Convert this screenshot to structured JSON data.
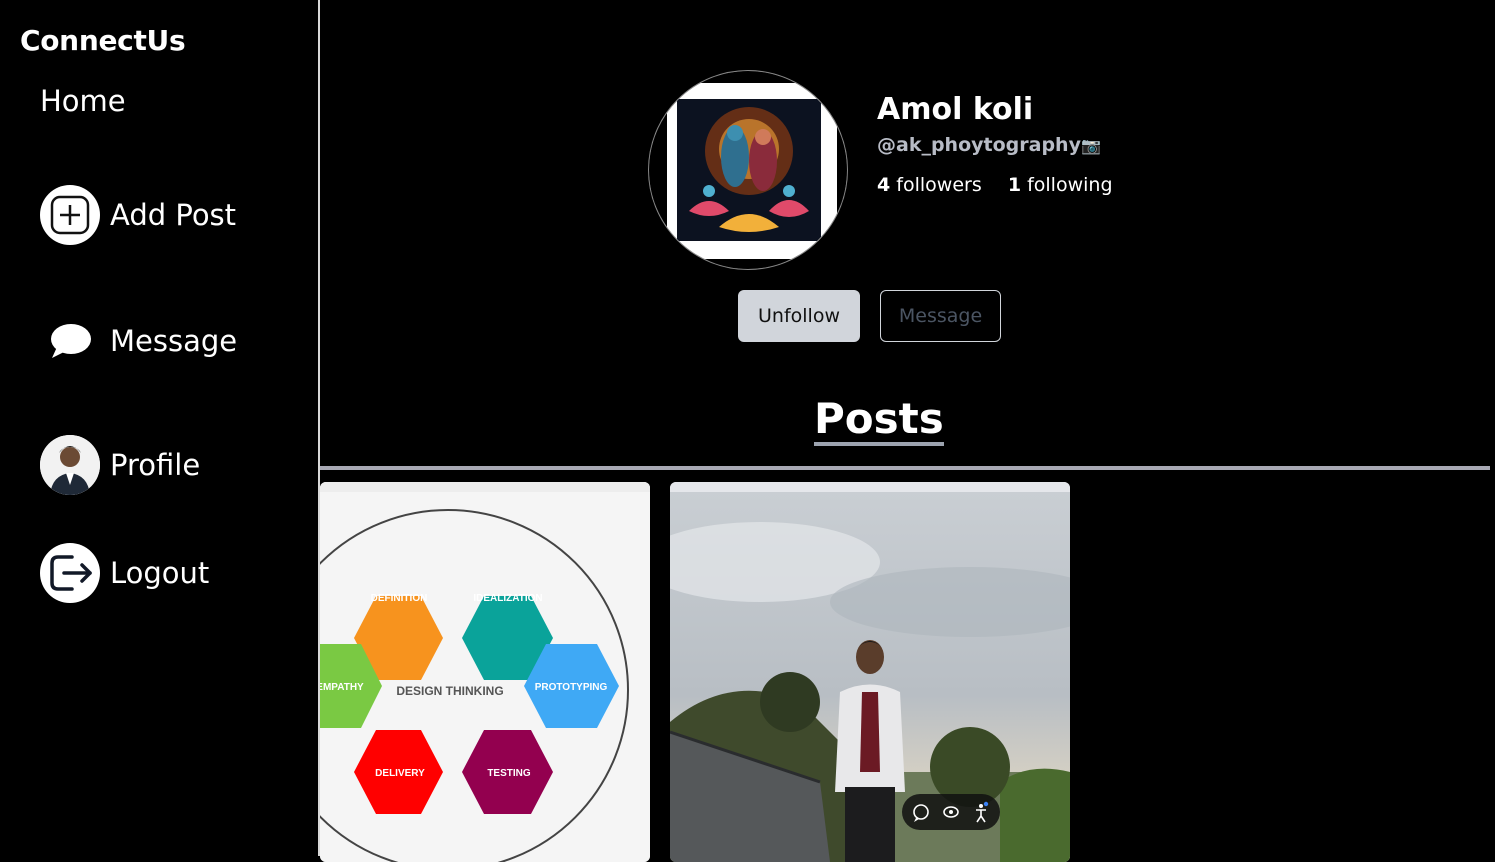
{
  "app": {
    "brand": "ConnectUs"
  },
  "sidebar": {
    "home_label": "Home",
    "items": [
      {
        "label": "Add Post",
        "icon": "plus-square-icon"
      },
      {
        "label": "Message",
        "icon": "chat-bubble-icon"
      },
      {
        "label": "Profile",
        "icon": "avatar"
      },
      {
        "label": "Logout",
        "icon": "logout-icon"
      }
    ]
  },
  "profile": {
    "name": "Amol koli",
    "handle": "@ak_phoytography",
    "handle_emoji": "📷",
    "followers_count": "4",
    "followers_label": "followers",
    "following_count": "1",
    "following_label": "following"
  },
  "actions": {
    "unfollow_label": "Unfollow",
    "message_label": "Message"
  },
  "posts": {
    "title": "Posts",
    "diagram": {
      "center": "DESIGN THINKING",
      "nodes": [
        {
          "label": "DEFINITION",
          "color": "#f7931e"
        },
        {
          "label": "IDEALIZATION",
          "color": "#0aa39a"
        },
        {
          "label": "EMPATHY",
          "color": "#7ac943"
        },
        {
          "label": "PROTOTYPING",
          "color": "#3fa9f5"
        },
        {
          "label": "DELIVERY",
          "color": "#ff0000"
        },
        {
          "label": "TESTING",
          "color": "#93004f"
        }
      ]
    }
  }
}
